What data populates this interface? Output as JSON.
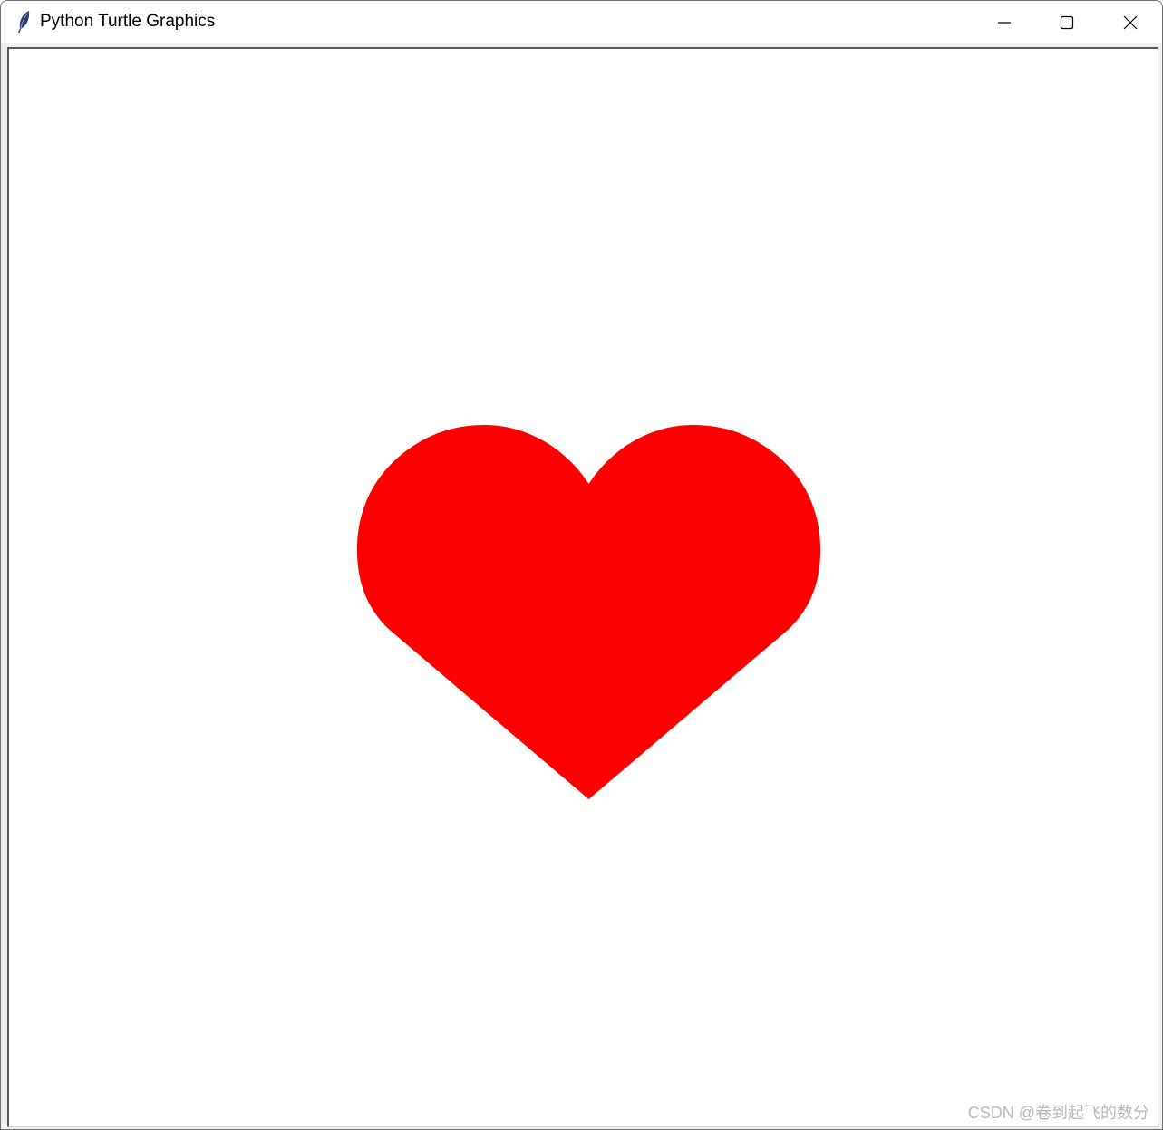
{
  "window": {
    "title": "Python Turtle Graphics",
    "app_icon": "feather-icon",
    "controls": {
      "minimize_icon": "minimize-icon",
      "maximize_icon": "maximize-icon",
      "close_icon": "close-icon"
    }
  },
  "canvas": {
    "background": "#ffffff",
    "shape": {
      "type": "heart",
      "fill_color": "#ff0000"
    }
  },
  "watermark": {
    "text": "CSDN @卷到起飞的数分"
  }
}
